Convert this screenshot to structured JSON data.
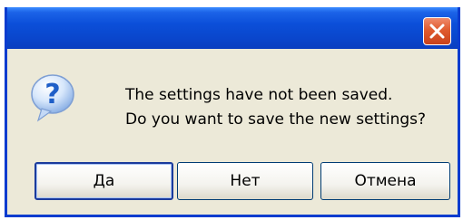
{
  "dialog": {
    "title": "",
    "message_line1": "The settings have not been saved.",
    "message_line2": "Do you want to save the new settings?",
    "icon": "question-icon",
    "close_icon": "close-icon"
  },
  "buttons": {
    "yes_label": "Да",
    "no_label": "Нет",
    "cancel_label": "Отмена"
  },
  "colors": {
    "titlebar": "#0a46cc",
    "body": "#ece9d8",
    "close_button": "#e05b2f",
    "icon_blue": "#2f6fd6"
  }
}
